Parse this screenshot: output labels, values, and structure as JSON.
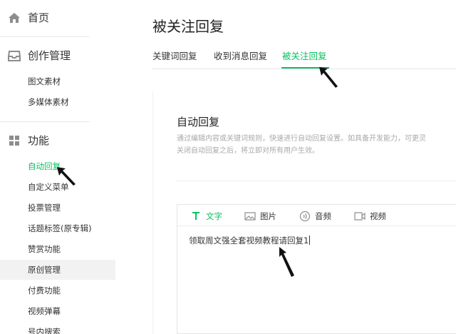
{
  "sidebar": {
    "home": {
      "label": "首页",
      "icon": "home-icon"
    },
    "create": {
      "label": "创作管理",
      "icon": "inbox-icon"
    },
    "create_items": [
      "图文素材",
      "多媒体素材"
    ],
    "features": {
      "label": "功能",
      "icon": "grid-icon"
    },
    "feature_items": [
      "自动回复",
      "自定义菜单",
      "投票管理",
      "话题标签(原专辑)",
      "赞赏功能",
      "原创管理",
      "付费功能",
      "视频弹幕",
      "号内搜索"
    ],
    "active_item": "自动回复",
    "highlight_item": "原创管理"
  },
  "main": {
    "title": "被关注回复",
    "tabs": [
      "关键词回复",
      "收到消息回复",
      "被关注回复"
    ],
    "active_tab": "被关注回复",
    "section_title": "自动回复",
    "description_line1": "通过编辑内容或关键词规则，快速进行自动回复设置。如具备开发能力，可更灵",
    "description_line2": "关闭自动回复之后，将立即对所有用户生效。",
    "editor": {
      "tools": [
        {
          "label": "文字",
          "icon": "text-icon"
        },
        {
          "label": "图片",
          "icon": "image-icon"
        },
        {
          "label": "音频",
          "icon": "audio-icon"
        },
        {
          "label": "视频",
          "icon": "video-icon"
        }
      ],
      "active_tool": "文字",
      "content": "领取周文强全套视频教程请回复1"
    }
  },
  "colors": {
    "accent": "#07c160",
    "text": "#353535",
    "muted": "#a9a9a9",
    "divider": "#e7e7eb"
  }
}
